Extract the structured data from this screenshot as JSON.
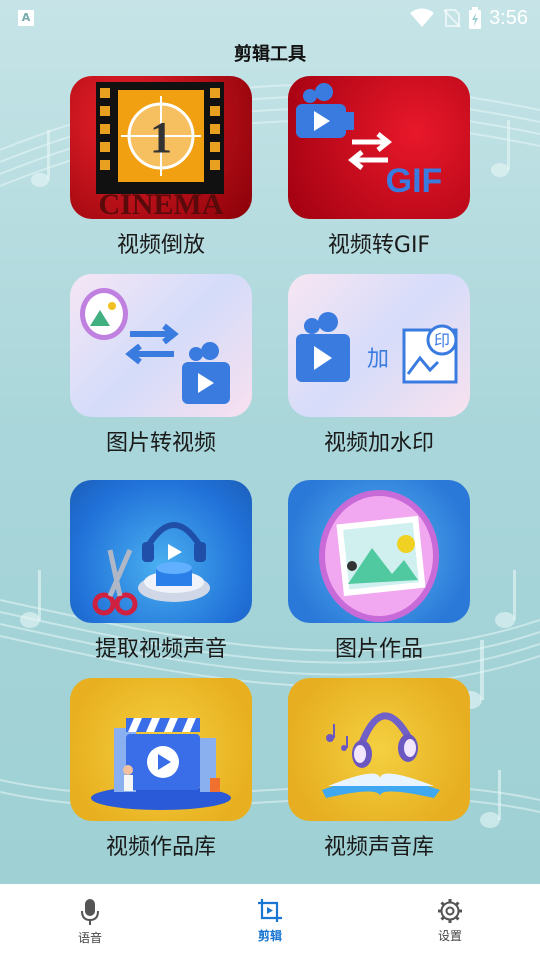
{
  "status": {
    "time": "3:56"
  },
  "header": {
    "title": "剪辑工具"
  },
  "tools": [
    {
      "label": "视频倒放",
      "icon": "cinema-reverse-icon",
      "art_text": "CINEMA",
      "art_num": "1"
    },
    {
      "label": "视频转GIF",
      "icon": "video-to-gif-icon",
      "art_text": "GIF"
    },
    {
      "label": "图片转视频",
      "icon": "image-to-video-icon"
    },
    {
      "label": "视频加水印",
      "icon": "video-watermark-icon",
      "art_text": "加",
      "art_stamp": "印"
    },
    {
      "label": "提取视频声音",
      "icon": "extract-audio-icon"
    },
    {
      "label": "图片作品",
      "icon": "image-works-icon"
    },
    {
      "label": "视频作品库",
      "icon": "video-library-icon"
    },
    {
      "label": "视频声音库",
      "icon": "audio-library-icon"
    }
  ],
  "tabbar": [
    {
      "label": "语音",
      "icon": "microphone-icon",
      "active": false
    },
    {
      "label": "剪辑",
      "icon": "crop-play-icon",
      "active": true
    },
    {
      "label": "设置",
      "icon": "gear-icon",
      "active": false
    }
  ],
  "colors": {
    "accent": "#1976d2",
    "background": "#b4dde0"
  }
}
